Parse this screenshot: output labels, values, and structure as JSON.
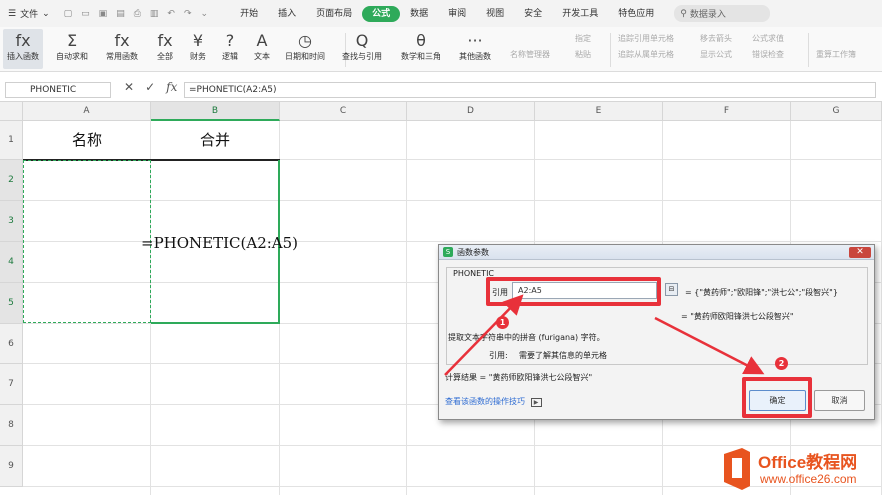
{
  "menubar": {
    "file_label": "文件",
    "tabs": [
      "开始",
      "插入",
      "页面布局",
      "公式",
      "数据",
      "审阅",
      "视图",
      "安全",
      "开发工具",
      "特色应用"
    ],
    "active_tab": "公式",
    "search_placeholder": "数据录入"
  },
  "ribbon": {
    "buttons": [
      "插入函数",
      "自动求和",
      "常用函数",
      "全部",
      "财务",
      "逻辑",
      "文本",
      "日期和时间",
      "查找与引用",
      "数学和三角",
      "其他函数"
    ],
    "icons": [
      "fx",
      "Σ",
      "fx",
      "fx",
      "¥",
      "?",
      "A",
      "◷",
      "Q",
      "θ",
      "···"
    ],
    "small_group1": [
      "名称管理器",
      "指定",
      "粘贴"
    ],
    "small_group2": [
      "追踪引用单元格",
      "追踪从属单元格",
      "移去箭头",
      "显示公式",
      "公式求值",
      "错误检查"
    ],
    "recalc": "重算工作簿"
  },
  "formula_bar": {
    "name_box": "PHONETIC",
    "formula": "=PHONETIC(A2:A5)"
  },
  "columns": [
    "A",
    "B",
    "C",
    "D",
    "E",
    "F",
    "G"
  ],
  "rows": [
    "1",
    "2",
    "3",
    "4",
    "5",
    "6",
    "7",
    "8",
    "9"
  ],
  "cells": {
    "a1": "名称",
    "b1": "合并",
    "b_formula": "=PHONETIC(A2:A5)"
  },
  "dialog": {
    "title": "函数参数",
    "func_name": "PHONETIC",
    "arg_label": "引用",
    "arg_value": "A2:A5",
    "arg_eval": "= {\"黄药师\";\"欧阳锋\";\"洪七公\";\"段智兴\"}",
    "result_preview": "= \"黄药师欧阳锋洪七公段智兴\"",
    "description": "提取文本字符串中的拼音 (furigana) 字符。",
    "arg_desc_label": "引用:",
    "arg_desc": "需要了解其信息的单元格",
    "calc_result": "计算结果 = \"黄药师欧阳锋洪七公段智兴\"",
    "help_link": "查看该函数的操作技巧",
    "ok": "确定",
    "cancel": "取消"
  },
  "annotations": {
    "badge1": "1",
    "badge2": "2",
    "color": "#e8313a"
  },
  "watermark": {
    "brand": "Office教程网",
    "url": "www.office26.com"
  }
}
